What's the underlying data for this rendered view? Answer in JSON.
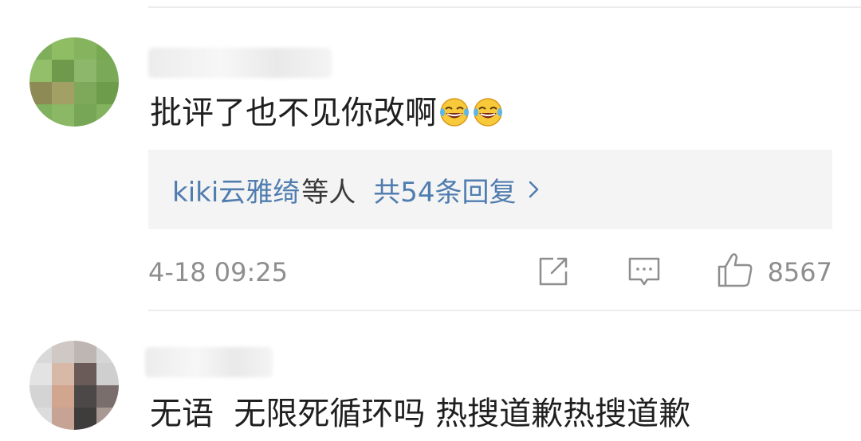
{
  "comments": [
    {
      "text": "批评了也不见你改啊",
      "emojis": [
        "laughing-tears-icon",
        "laughing-tears-icon"
      ],
      "reply_preview": {
        "names": "kiki云雅绮",
        "suffix": "等人",
        "count_label": "共54条回复"
      },
      "timestamp": "4-18 09:25",
      "likes": "8567"
    },
    {
      "text": "无语  无限死循环吗 热搜道歉热搜道歉"
    }
  ],
  "colors": {
    "link": "#507daf",
    "meta": "#8e8e8e",
    "reply_bg": "#f4f4f4"
  }
}
